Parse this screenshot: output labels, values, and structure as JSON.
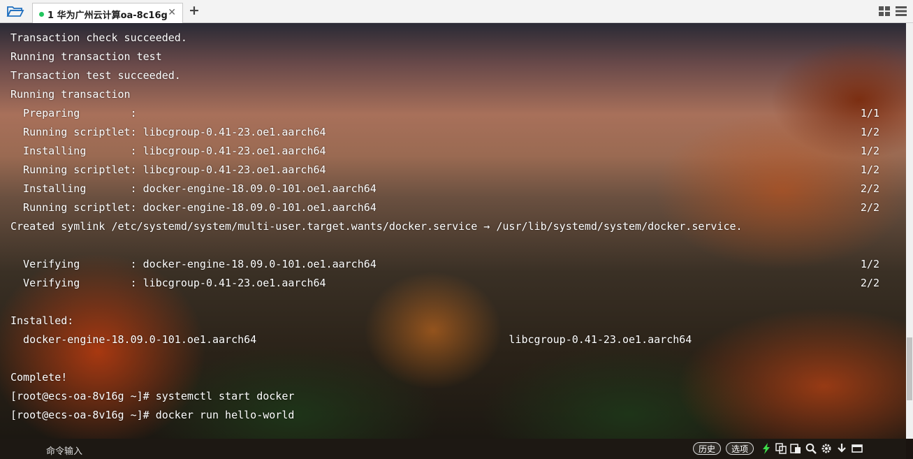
{
  "tabs": [
    {
      "label": "1 华为广州云计算oa-8c16g",
      "active": true,
      "status_color": "#22c55e",
      "close_glyph": "✕"
    }
  ],
  "new_tab_glyph": "+",
  "terminal": {
    "lines": [
      "Transaction check succeeded.",
      "Running transaction test",
      "Transaction test succeeded.",
      "Running transaction",
      "  Preparing        :",
      "  Running scriptlet: libcgroup-0.41-23.oe1.aarch64",
      "  Installing       : libcgroup-0.41-23.oe1.aarch64",
      "  Running scriptlet: libcgroup-0.41-23.oe1.aarch64",
      "  Installing       : docker-engine-18.09.0-101.oe1.aarch64",
      "  Running scriptlet: docker-engine-18.09.0-101.oe1.aarch64",
      "Created symlink /etc/systemd/system/multi-user.target.wants/docker.service → /usr/lib/systemd/system/docker.service.",
      "",
      "  Verifying        : docker-engine-18.09.0-101.oe1.aarch64",
      "  Verifying        : libcgroup-0.41-23.oe1.aarch64",
      "",
      "Installed:",
      "  docker-engine-18.09.0-101.oe1.aarch64                                        libcgroup-0.41-23.oe1.aarch64",
      "",
      "Complete!",
      "[root@ecs-oa-8v16g ~]# systemctl start docker",
      "[root@ecs-oa-8v16g ~]# docker run hello-world"
    ],
    "counts": [
      "",
      "",
      "",
      "",
      "1/1",
      "1/2",
      "1/2",
      "1/2",
      "2/2",
      "2/2",
      "",
      "",
      "1/2",
      "2/2",
      "",
      "",
      "",
      "",
      "",
      "",
      ""
    ]
  },
  "bottom": {
    "command_placeholder": "命令输入",
    "history_label": "历史",
    "options_label": "选项",
    "icons": [
      "lightning-icon",
      "copy-icon",
      "paste-icon",
      "search-icon",
      "gear-icon",
      "download-icon",
      "window-icon"
    ],
    "accent_green": "#3ddc4a"
  }
}
